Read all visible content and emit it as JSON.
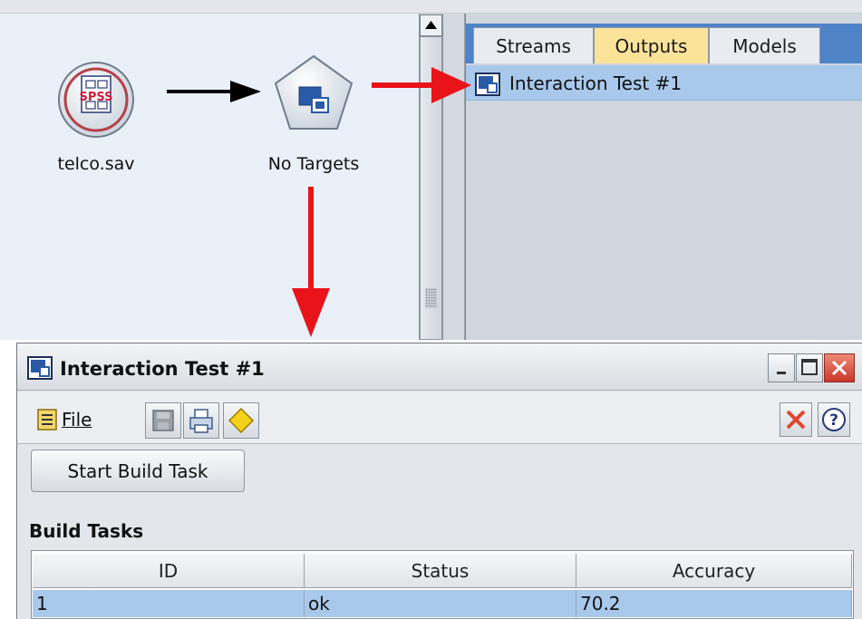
{
  "canvas": {
    "source_node": {
      "label": "telco.sav",
      "icon": "spss-file-icon"
    },
    "target_node": {
      "label": "No Targets",
      "icon": "interaction-node-icon"
    }
  },
  "manager": {
    "tabs": [
      {
        "label": "Streams",
        "active": false
      },
      {
        "label": "Outputs",
        "active": true
      },
      {
        "label": "Models",
        "active": false
      }
    ],
    "outputs": [
      {
        "label": "Interaction Test #1",
        "icon": "output-window-icon"
      }
    ]
  },
  "window": {
    "title": "Interaction Test #1",
    "controls": [
      "minimize-icon",
      "maximize-icon",
      "close-icon"
    ],
    "menu": {
      "file_label": "File"
    },
    "start_button": "Start Build Task",
    "section_title": "Build Tasks",
    "table": {
      "columns": [
        "ID",
        "Status",
        "Accuracy"
      ],
      "rows": [
        [
          "1",
          "ok",
          "70.2"
        ]
      ]
    }
  },
  "colors": {
    "canvas_bg": "#e9f0f8",
    "tab_active": "#fbe39a",
    "tab_strip": "#4f83c8",
    "selection": "#a9c9ec",
    "arrow_red": "#e8141a",
    "close_red": "#e0462f"
  }
}
